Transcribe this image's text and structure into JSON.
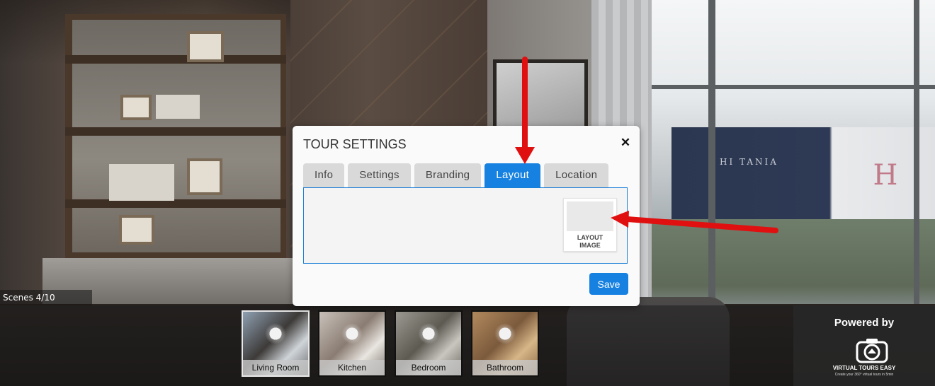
{
  "scenes_counter": "Scenes 4/10",
  "dialog": {
    "title": "TOUR SETTINGS",
    "close_icon": "close-icon",
    "tabs": [
      {
        "label": "Info",
        "active": false
      },
      {
        "label": "Settings",
        "active": false
      },
      {
        "label": "Branding",
        "active": false
      },
      {
        "label": "Layout",
        "active": true
      },
      {
        "label": "Location",
        "active": false
      }
    ],
    "layout_image_label": "LAYOUT IMAGE",
    "save_label": "Save"
  },
  "scenes": [
    {
      "label": "Living Room",
      "active": true
    },
    {
      "label": "Kitchen",
      "active": false
    },
    {
      "label": "Bedroom",
      "active": false
    },
    {
      "label": "Bathroom",
      "active": false
    }
  ],
  "powered": {
    "title": "Powered by",
    "brand": "VIRTUAL TOURS EASY",
    "tagline": "Create your 360° virtual tours in 5min"
  },
  "background": {
    "signage_text": "HI   TANIA",
    "signage_logo": "H"
  },
  "colors": {
    "accent": "#1681e0",
    "annotation_arrow": "#e01010"
  }
}
